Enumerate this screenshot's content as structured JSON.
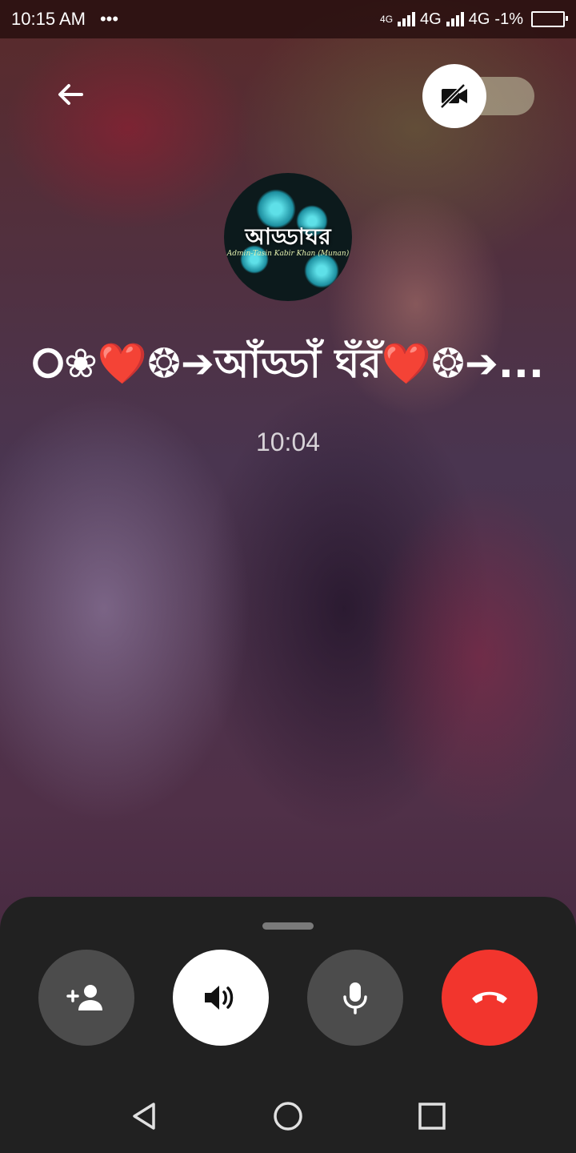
{
  "status_bar": {
    "time": "10:15 AM",
    "more": "•••",
    "net1": "4G",
    "net2": "4G",
    "net3": "4G",
    "battery": "-1%"
  },
  "call": {
    "caller_name": "⭘❀❤️❂➔আঁড্ডাঁ ঘঁরঁ❤️❂➔...",
    "timer": "10:04"
  },
  "avatar": {
    "title": "আড্ডাঘর",
    "subtitle": "Admin-Tasin Kabir Khan (Munan)"
  },
  "controls": {
    "add_person": "add-person",
    "speaker": "speaker",
    "mic": "microphone",
    "end_call": "end-call"
  },
  "icons": {
    "back": "arrow-left-icon",
    "video_off": "video-off-icon",
    "add_person": "person-add-icon",
    "speaker": "volume-icon",
    "mic": "mic-icon",
    "end_call": "phone-hangup-icon",
    "nav_back": "triangle-back-icon",
    "nav_home": "circle-home-icon",
    "nav_recent": "square-recents-icon"
  },
  "colors": {
    "end_call": "#f2352d",
    "panel": "#212121",
    "control_dark": "#4c4c4c",
    "control_light": "#ffffff"
  }
}
